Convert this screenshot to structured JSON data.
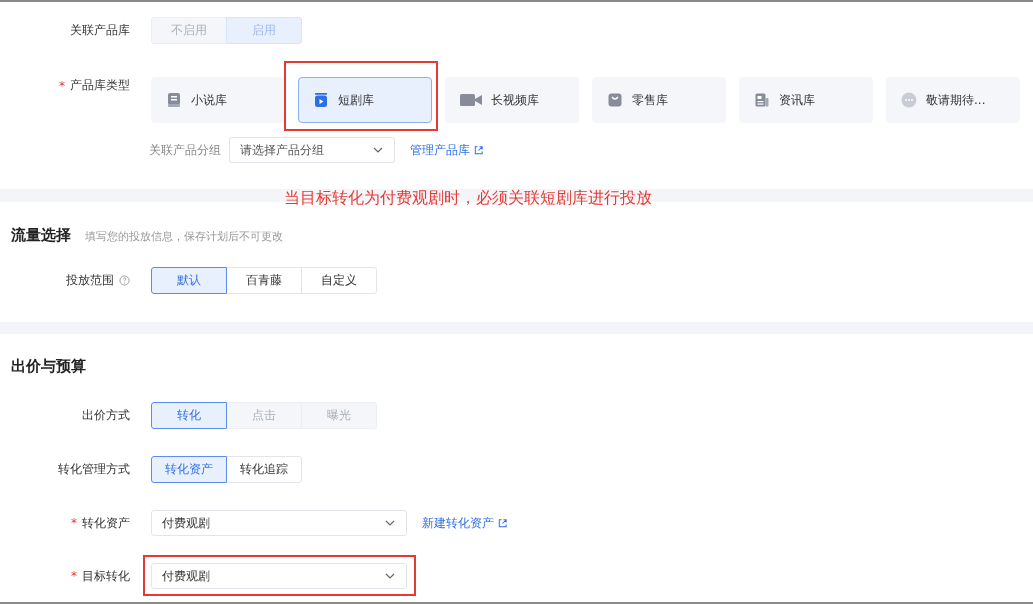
{
  "product_library": {
    "label": "关联产品库",
    "options": [
      {
        "label": "不启用",
        "selected": false,
        "disabled": true
      },
      {
        "label": "启用",
        "selected": true,
        "disabled": true
      }
    ]
  },
  "product_type": {
    "label": "产品库类型",
    "required_mark": "*",
    "cards": [
      {
        "label": "小说库",
        "kind": "book",
        "selected": false,
        "highlighted": false
      },
      {
        "label": "短剧库",
        "kind": "drama",
        "selected": true,
        "highlighted": true
      },
      {
        "label": "长视频库",
        "kind": "video",
        "selected": false,
        "highlighted": false
      },
      {
        "label": "零售库",
        "kind": "bag",
        "selected": false,
        "highlighted": false
      },
      {
        "label": "资讯库",
        "kind": "news",
        "selected": false,
        "highlighted": false
      },
      {
        "label": "敬请期待...",
        "kind": "more",
        "selected": false,
        "highlighted": false
      }
    ],
    "group_label": "关联产品分组",
    "group_placeholder": "请选择产品分组",
    "manage_link": "管理产品库"
  },
  "annotation": "当目标转化为付费观剧时，必须关联短剧库进行投放",
  "traffic": {
    "title": "流量选择",
    "hint": "填写您的投放信息，保存计划后不可更改",
    "scope": {
      "label": "投放范围",
      "options": [
        {
          "label": "默认",
          "selected": true,
          "disabled": false
        },
        {
          "label": "百青藤",
          "selected": false,
          "disabled": false
        },
        {
          "label": "自定义",
          "selected": false,
          "disabled": false
        }
      ]
    }
  },
  "bidding": {
    "title": "出价与预算",
    "bid_method": {
      "label": "出价方式",
      "options": [
        {
          "label": "转化",
          "selected": true,
          "disabled": false
        },
        {
          "label": "点击",
          "selected": false,
          "disabled": true
        },
        {
          "label": "曝光",
          "selected": false,
          "disabled": true
        }
      ]
    },
    "conversion_mode": {
      "label": "转化管理方式",
      "options": [
        {
          "label": "转化资产",
          "selected": true,
          "disabled": false
        },
        {
          "label": "转化追踪",
          "selected": false,
          "disabled": false
        }
      ]
    },
    "asset": {
      "label": "转化资产",
      "required_mark": "*",
      "value": "付费观剧",
      "link": "新建转化资产"
    },
    "target": {
      "label": "目标转化",
      "required_mark": "*",
      "value": "付费观剧",
      "highlighted": true
    }
  }
}
